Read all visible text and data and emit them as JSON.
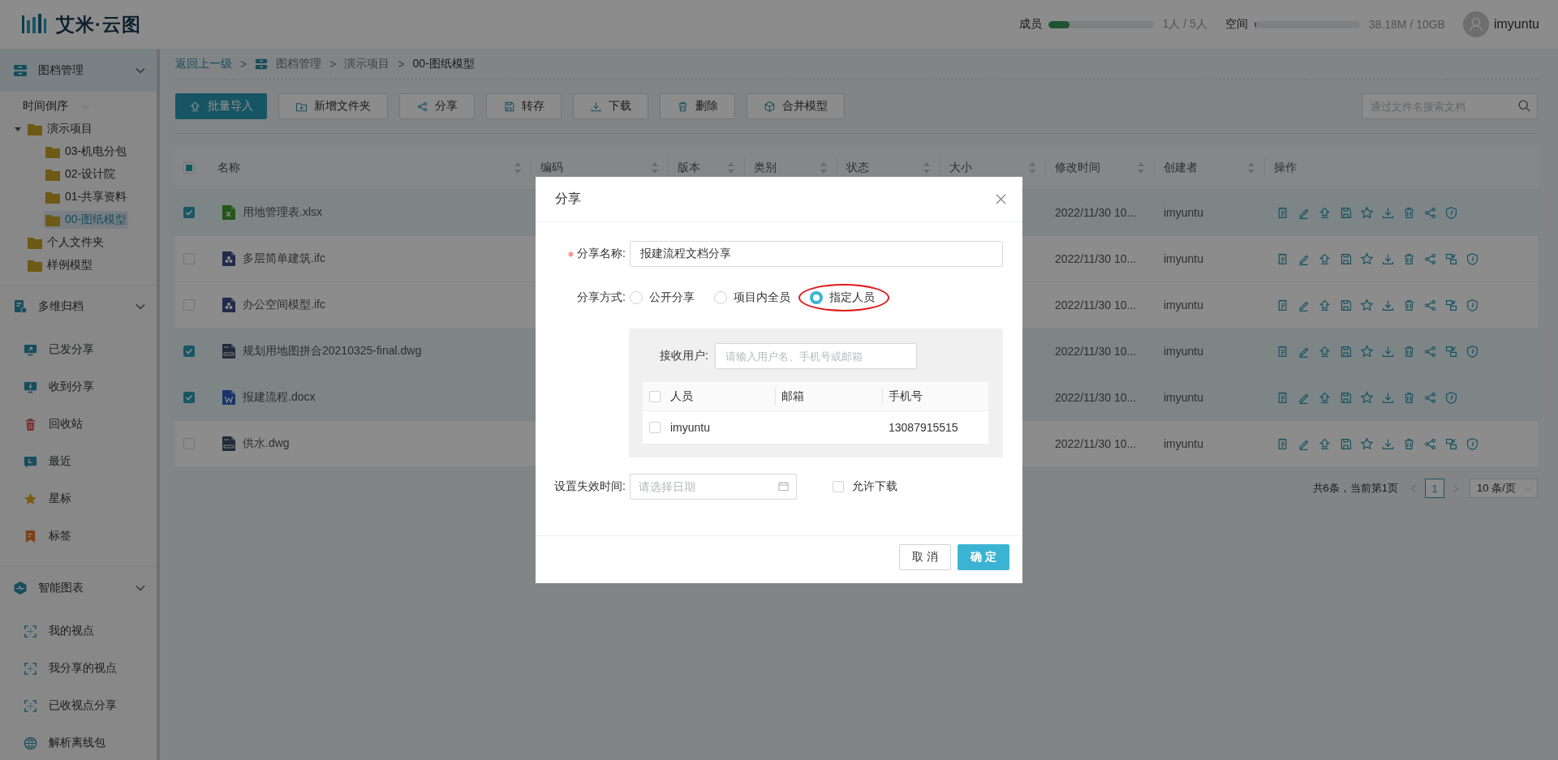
{
  "header": {
    "logo": "艾米·云图",
    "members": {
      "label": "成员",
      "level": 0.2,
      "reading": "1人 / 5人"
    },
    "space": {
      "label": "空间",
      "level": 0.005,
      "reading": "38.18M / 10GB"
    },
    "user": "imyuntu"
  },
  "sidebar": {
    "sections": [
      {
        "title": "图档管理",
        "kind": "drawer",
        "expanded": true,
        "selected": true,
        "sort": "时间倒序",
        "tree": [
          {
            "label": "演示项目",
            "expanded": true,
            "selected": false,
            "children": [
              {
                "label": "03-机电分包",
                "selected": false
              },
              {
                "label": "02-设计院",
                "selected": false
              },
              {
                "label": "01-共享资料",
                "selected": false
              },
              {
                "label": "00-图纸模型",
                "selected": true
              }
            ]
          },
          {
            "label": "个人文件夹",
            "selected": false
          },
          {
            "label": "样例模型",
            "selected": false
          }
        ]
      },
      {
        "title": "多维归档",
        "kind": "document",
        "expanded": true,
        "selected": false,
        "items": [
          {
            "label": "已发分享",
            "kind": "share-out"
          },
          {
            "label": "收到分享",
            "kind": "share-in"
          },
          {
            "label": "回收站",
            "kind": "trash"
          },
          {
            "label": "最近",
            "kind": "recent"
          },
          {
            "label": "星标",
            "kind": "star"
          },
          {
            "label": "标签",
            "kind": "tag"
          }
        ]
      },
      {
        "title": "智能图表",
        "kind": "chart",
        "expanded": true,
        "selected": false,
        "items": [
          {
            "label": "我的视点",
            "kind": "viewpoint"
          },
          {
            "label": "我分享的视点",
            "kind": "viewpoint"
          },
          {
            "label": "已收视点分享",
            "kind": "viewpoint"
          },
          {
            "label": "解析离线包",
            "kind": "globe"
          }
        ]
      }
    ]
  },
  "breadcrumb": {
    "back": "返回上一级",
    "separator": ">",
    "path": [
      "图档管理",
      "演示项目",
      "00-图纸模型"
    ]
  },
  "toolbar": {
    "buttons": [
      {
        "label": "批量导入",
        "kind": "import",
        "primary": true
      },
      {
        "label": "新增文件夹",
        "kind": "folder",
        "primary": false
      },
      {
        "label": "分享",
        "kind": "share",
        "primary": false
      },
      {
        "label": "转存",
        "kind": "save",
        "primary": false
      },
      {
        "label": "下载",
        "kind": "download",
        "primary": false
      },
      {
        "label": "删除",
        "kind": "delete",
        "primary": false
      },
      {
        "label": "合并模型",
        "kind": "merge",
        "primary": false
      }
    ],
    "search": {
      "placeholder": "通过文件名搜索文档"
    }
  },
  "table": {
    "select_all_indeterminate": true,
    "columns": [
      {
        "label": "名称",
        "sortable": true
      },
      {
        "label": "编码",
        "sortable": true
      },
      {
        "label": "版本",
        "sortable": true
      },
      {
        "label": "类别",
        "sortable": true
      },
      {
        "label": "状态",
        "sortable": true
      },
      {
        "label": "大小",
        "sortable": true
      },
      {
        "label": "修改时间",
        "sortable": true
      },
      {
        "label": "创建者",
        "sortable": true
      },
      {
        "label": "操作",
        "sortable": false
      }
    ],
    "rows": [
      {
        "name": "用地管理表.xlsx",
        "kind": "xlsx",
        "selected": true,
        "modified": "2022/11/30 10...",
        "creator": "imyuntu",
        "merge_action": false
      },
      {
        "name": "多层简单建筑.ifc",
        "kind": "ifc",
        "selected": false,
        "modified": "2022/11/30 10...",
        "creator": "imyuntu",
        "merge_action": true
      },
      {
        "name": "办公空间模型.ifc",
        "kind": "ifc",
        "selected": false,
        "modified": "2022/11/30 10...",
        "creator": "imyuntu",
        "merge_action": true
      },
      {
        "name": "规划用地图拼合20210325-final.dwg",
        "kind": "dwg",
        "selected": true,
        "modified": "2022/11/30 10...",
        "creator": "imyuntu",
        "merge_action": true
      },
      {
        "name": "报建流程.docx",
        "kind": "docx",
        "selected": true,
        "modified": "2022/11/30 10...",
        "creator": "imyuntu",
        "merge_action": false
      },
      {
        "name": "供水.dwg",
        "kind": "dwg",
        "selected": false,
        "modified": "2022/11/30 10...",
        "creator": "imyuntu",
        "merge_action": true
      }
    ]
  },
  "pagination": {
    "summary": "共6条，当前第1页",
    "page": "1",
    "page_size": "10 条/页"
  },
  "dialog": {
    "title": "分享",
    "name_field": {
      "label": "分享名称:",
      "required": true,
      "value": "报建流程文档分享"
    },
    "mode": {
      "label": "分享方式:",
      "options": [
        {
          "label": "公开分享",
          "selected": false,
          "highlighted": false
        },
        {
          "label": "项目内全员",
          "selected": false,
          "highlighted": false
        },
        {
          "label": "指定人员",
          "selected": true,
          "highlighted": true
        }
      ]
    },
    "recipients": {
      "label": "接收用户:",
      "placeholder": "请输入用户名、手机号或邮箱",
      "all_checked": false,
      "columns": [
        "人员",
        "邮箱",
        "手机号"
      ],
      "rows": [
        {
          "person": "imyuntu",
          "phone": "13087915515",
          "checked": false
        }
      ]
    },
    "expiry": {
      "label": "设置失效时间:",
      "placeholder": "请选择日期"
    },
    "allow_download": {
      "label": "允许下载",
      "checked": false
    },
    "buttons": [
      {
        "label": "取 消",
        "primary": false
      },
      {
        "label": "确 定",
        "primary": true
      }
    ]
  }
}
